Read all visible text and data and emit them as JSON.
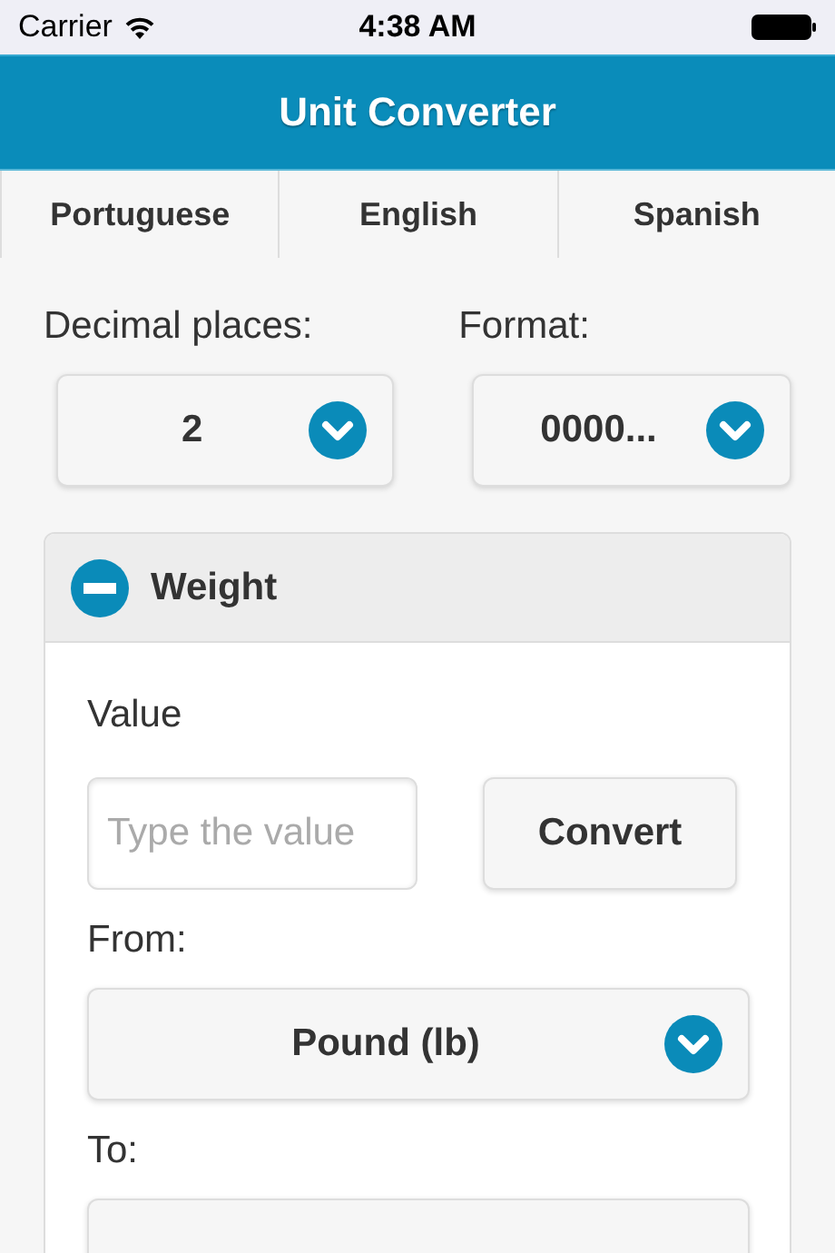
{
  "status_bar": {
    "carrier": "Carrier",
    "time": "4:38 AM"
  },
  "header": {
    "title": "Unit Converter"
  },
  "tabs": [
    {
      "label": "Portuguese",
      "selected": false
    },
    {
      "label": "English",
      "selected": false
    },
    {
      "label": "Spanish",
      "selected": false
    }
  ],
  "settings": [
    {
      "label": "Decimal places:",
      "value": "2"
    },
    {
      "label": "Format:",
      "value": "0000..."
    }
  ],
  "section": {
    "title": "Weight",
    "expanded": true,
    "value_label": "Value",
    "value_field": {
      "placeholder": "Type the value"
    },
    "convert_button": "Convert",
    "from_label": "From:",
    "from_value": "Pound (lb)",
    "to_label": "To:"
  }
}
